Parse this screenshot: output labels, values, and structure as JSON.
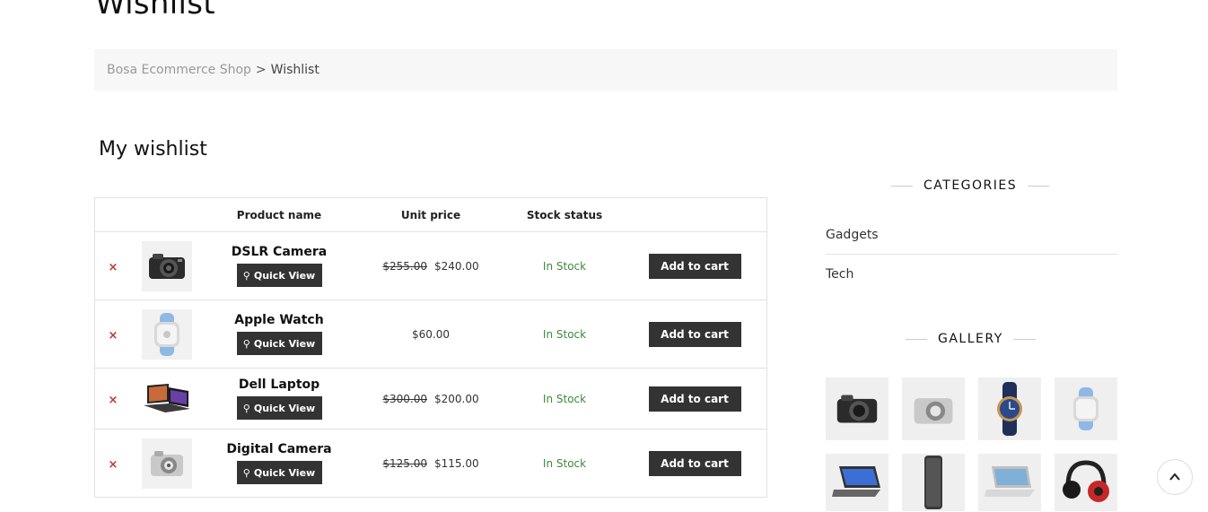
{
  "page": {
    "heading": "Wishlist"
  },
  "breadcrumb": {
    "home": "Bosa Ecommerce Shop",
    "separator": ">",
    "current": "Wishlist"
  },
  "wishlist": {
    "title": "My wishlist",
    "headers": {
      "product_name": "Product name",
      "unit_price": "Unit price",
      "stock_status": "Stock status"
    },
    "remove_symbol": "×",
    "quick_view_label": "Quick View",
    "add_to_cart_label": "Add to cart",
    "items": [
      {
        "name": "DSLR Camera",
        "old_price": "$255.00",
        "price": "$240.00",
        "stock": "In Stock",
        "icon": "dslr-camera-icon"
      },
      {
        "name": "Apple Watch",
        "old_price": "",
        "price": "$60.00",
        "stock": "In Stock",
        "icon": "smartwatch-icon"
      },
      {
        "name": "Dell Laptop",
        "old_price": "$300.00",
        "price": "$200.00",
        "stock": "In Stock",
        "icon": "laptop-icon"
      },
      {
        "name": "Digital Camera",
        "old_price": "$125.00",
        "price": "$115.00",
        "stock": "In Stock",
        "icon": "compact-camera-icon"
      }
    ]
  },
  "sidebar": {
    "categories_title": "CATEGORIES",
    "categories": [
      "Gadgets",
      "Tech"
    ],
    "gallery_title": "GALLERY",
    "gallery_icons": [
      "dslr-camera-icon",
      "compact-camera-icon",
      "wristwatch-icon",
      "smartwatch-icon",
      "laptop-icon",
      "phone-icon",
      "laptop-silver-icon",
      "headphones-icon"
    ]
  },
  "colors": {
    "button_dark": "#333333",
    "in_stock": "#3c8a3c",
    "remove": "#c0392b",
    "breadcrumb_bg": "#f7f7f7"
  }
}
